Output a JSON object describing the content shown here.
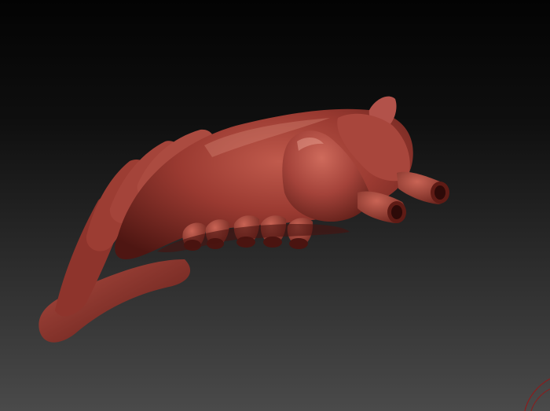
{
  "viewport": {
    "background_top": "#030303",
    "background_bottom": "#4a4a4a"
  },
  "model": {
    "material_color": "#9a3a31",
    "material_shadow": "#4e1612",
    "material_highlight": "#d98b7a"
  },
  "gizmo": {
    "icon": "axis-gizmo-icon",
    "color": "#8c1c1c"
  }
}
